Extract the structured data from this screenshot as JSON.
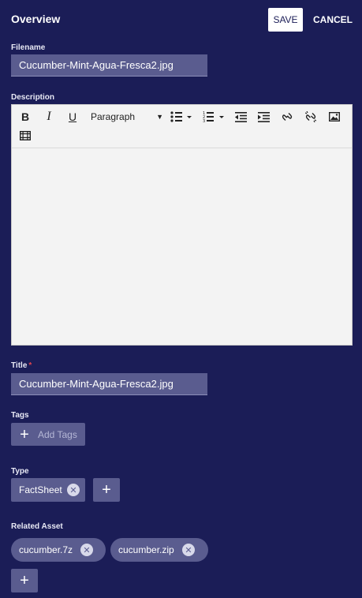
{
  "header": {
    "title": "Overview",
    "save_label": "SAVE",
    "cancel_label": "CANCEL"
  },
  "filename": {
    "label": "Filename",
    "value": "Cucumber-Mint-Agua-Fresca2.jpg"
  },
  "description": {
    "label": "Description",
    "toolbar": {
      "bold": "B",
      "italic": "I",
      "underline": "U",
      "format_value": "Paragraph",
      "icons": [
        "bold-icon",
        "italic-icon",
        "underline-icon",
        "bulleted-list-icon",
        "numbered-list-icon",
        "outdent-icon",
        "indent-icon",
        "link-icon",
        "unlink-icon",
        "image-icon",
        "video-icon"
      ]
    },
    "content": ""
  },
  "title_field": {
    "label": "Title",
    "required_mark": "*",
    "value": "Cucumber-Mint-Agua-Fresca2.jpg"
  },
  "tags": {
    "label": "Tags",
    "add_label": "Add Tags"
  },
  "type": {
    "label": "Type",
    "chips": [
      "FactSheet"
    ]
  },
  "related_asset": {
    "label": "Related Asset",
    "chips": [
      "cucumber.7z",
      "cucumber.zip"
    ]
  },
  "colors": {
    "background": "#1b1d57",
    "field": "#5a5c8f",
    "required": "#e0444e"
  }
}
